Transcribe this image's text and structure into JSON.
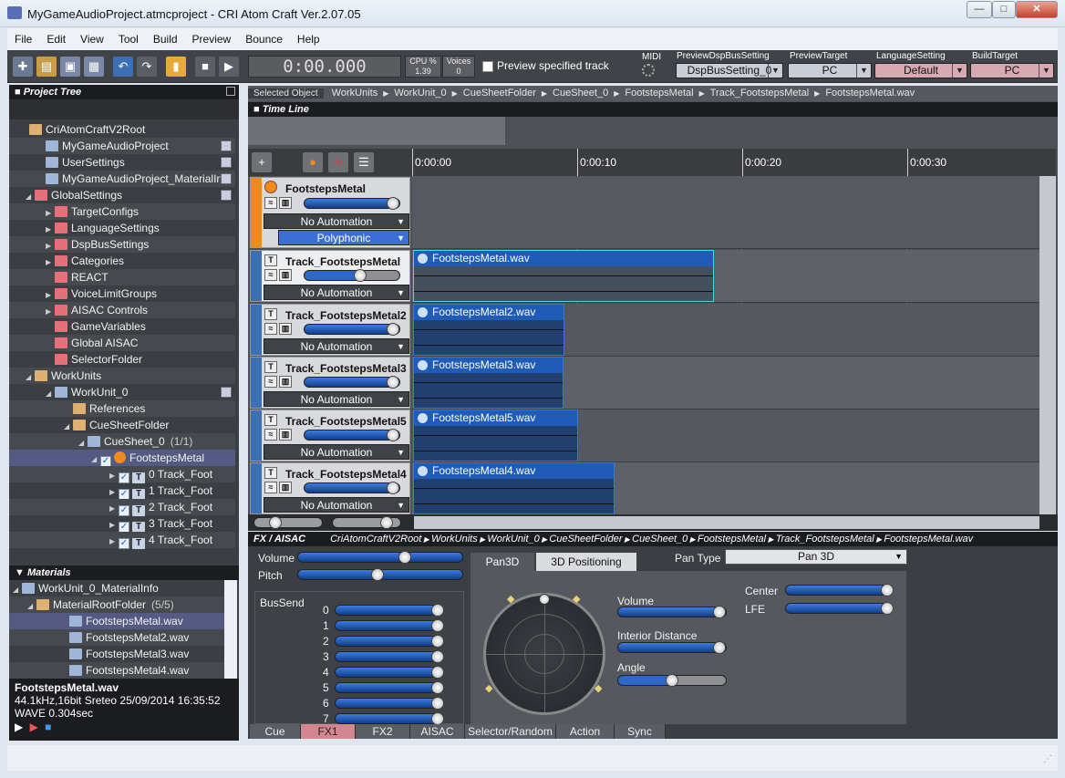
{
  "window": {
    "title": "MyGameAudioProject.atmcproject - CRI Atom Craft Ver.2.07.05"
  },
  "menu": [
    "File",
    "Edit",
    "View",
    "Tool",
    "Build",
    "Preview",
    "Bounce",
    "Help"
  ],
  "toolbar": {
    "time": "0:00.000",
    "cpu_label": "CPU %",
    "cpu_value": "1.39",
    "voices_label": "Voices",
    "voices_value": "0",
    "preview_track": "Preview specified track",
    "midi": "MIDI",
    "dspbus_label": "PreviewDspBusSetting",
    "dspbus_value": "DspBusSetting_0",
    "target_label": "PreviewTarget",
    "target_value": "PC",
    "lang_label": "LanguageSetting",
    "lang_value": "Default",
    "build_label": "BuildTarget",
    "build_value": "PC"
  },
  "project_tree": {
    "title": "Project Tree",
    "items": [
      {
        "label": "CriAtomCraftV2Root",
        "icon": "folder-open-icon"
      },
      {
        "label": "MyGameAudioProject",
        "icon": "project-icon"
      },
      {
        "label": "UserSettings",
        "icon": "user-settings-icon"
      },
      {
        "label": "MyGameAudioProject_MaterialInfo",
        "icon": "material-info-icon"
      },
      {
        "label": "GlobalSettings",
        "icon": "folder-icon"
      },
      {
        "label": "TargetConfigs",
        "icon": "folder-icon"
      },
      {
        "label": "LanguageSettings",
        "icon": "folder-icon"
      },
      {
        "label": "DspBusSettings",
        "icon": "folder-icon"
      },
      {
        "label": "Categories",
        "icon": "folder-icon"
      },
      {
        "label": "REACT",
        "icon": "folder-icon"
      },
      {
        "label": "VoiceLimitGroups",
        "icon": "folder-icon"
      },
      {
        "label": "AISAC Controls",
        "icon": "folder-icon"
      },
      {
        "label": "GameVariables",
        "icon": "folder-icon"
      },
      {
        "label": "Global AISAC",
        "icon": "folder-icon"
      },
      {
        "label": "SelectorFolder",
        "icon": "folder-icon"
      },
      {
        "label": "WorkUnits",
        "icon": "folder-icon"
      },
      {
        "label": "WorkUnit_0",
        "icon": "workunit-icon"
      },
      {
        "label": "References",
        "icon": "folder-icon"
      },
      {
        "label": "CueSheetFolder",
        "icon": "folder-icon"
      },
      {
        "label": "CueSheet_0",
        "icon": "cuesheet-icon",
        "count": "(1/1)"
      },
      {
        "label": "FootstepsMetal",
        "icon": "cue-icon"
      },
      {
        "label": "0   Track_Foot",
        "icon": "track-icon"
      },
      {
        "label": "1   Track_Foot",
        "icon": "track-icon"
      },
      {
        "label": "2   Track_Foot",
        "icon": "track-icon"
      },
      {
        "label": "3   Track_Foot",
        "icon": "track-icon"
      },
      {
        "label": "4   Track_Foot",
        "icon": "track-icon"
      }
    ]
  },
  "materials": {
    "title": "Materials",
    "items": [
      {
        "label": "WorkUnit_0_MaterialInfo"
      },
      {
        "label": "MaterialRootFolder",
        "count": "(5/5)"
      },
      {
        "label": "FootstepsMetal.wav"
      },
      {
        "label": "FootstepsMetal2.wav"
      },
      {
        "label": "FootstepsMetal3.wav"
      },
      {
        "label": "FootstepsMetal4.wav"
      }
    ],
    "info_name": "FootstepsMetal.wav",
    "info_line1": "44.1kHz,16bit Sreteo   25/09/2014 16:35:52",
    "info_line2": "WAVE 0.304sec"
  },
  "breadcrumb": {
    "label": "Selected Object",
    "path": [
      "WorkUnits",
      "WorkUnit_0",
      "CueSheetFolder",
      "CueSheet_0",
      "FootstepsMetal",
      "Track_FootstepsMetal",
      "FootstepsMetal.wav"
    ]
  },
  "timeline": {
    "title": "Time Line",
    "ticks": [
      "0:00:00",
      "0:00:10",
      "0:00:20",
      "0:00:30"
    ],
    "cue": {
      "name": "FootstepsMetal",
      "automation": "No Automation",
      "mode": "Polyphonic"
    },
    "tracks": [
      {
        "name": "Track_FootstepsMetal",
        "automation": "No Automation",
        "wav": "FootstepsMetal.wav"
      },
      {
        "name": "Track_FootstepsMetal2",
        "automation": "No Automation",
        "wav": "FootstepsMetal2.wav"
      },
      {
        "name": "Track_FootstepsMetal3",
        "automation": "No Automation",
        "wav": "FootstepsMetal3.wav"
      },
      {
        "name": "Track_FootstepsMetal5",
        "automation": "No Automation",
        "wav": "FootstepsMetal5.wav"
      },
      {
        "name": "Track_FootstepsMetal4",
        "automation": "No Automation",
        "wav": "FootstepsMetal4.wav"
      }
    ]
  },
  "fx": {
    "title": "FX / AISAC",
    "path": [
      "CriAtomCraftV2Root",
      "WorkUnits",
      "WorkUnit_0",
      "CueSheetFolder",
      "CueSheet_0",
      "FootstepsMetal",
      "Track_FootstepsMetal",
      "FootstepsMetal.wav"
    ],
    "volume": "Volume",
    "pitch": "Pitch",
    "bussend": "BusSend",
    "bus_numbers": [
      "0",
      "1",
      "2",
      "3",
      "4",
      "5",
      "6",
      "7"
    ],
    "tab_pan3d": "Pan3D",
    "tab_3dpos": "3D Positioning",
    "pan_type_label": "Pan Type",
    "pan_type_value": "Pan 3D",
    "pan_volume": "Volume",
    "interior_distance": "Interior Distance",
    "angle": "Angle",
    "center": "Center",
    "lfe": "LFE"
  },
  "bottom_tabs": [
    "Cue",
    "FX1",
    "FX2",
    "AISAC",
    "Selector/Random",
    "Action",
    "Sync"
  ]
}
